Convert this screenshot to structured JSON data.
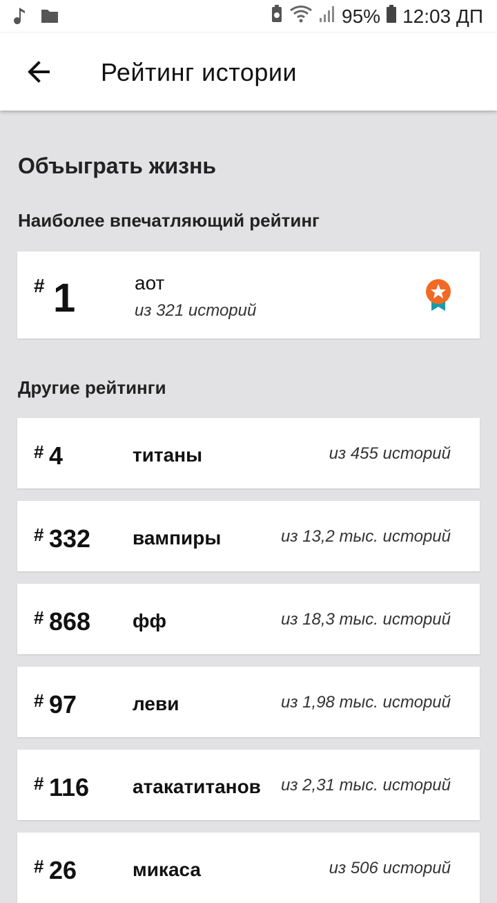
{
  "status_bar": {
    "battery": "95%",
    "time": "12:03 ДП"
  },
  "app_bar": {
    "title": "Рейтинг истории"
  },
  "story": {
    "title": "Объыграть жизнь"
  },
  "sections": {
    "top_heading": "Наиболее впечатляющий рейтинг",
    "other_heading": "Другие рейтинги"
  },
  "top_ranking": {
    "hash": "#",
    "rank": "1",
    "tag": "аот",
    "count": "из 321 историй"
  },
  "other_rankings": [
    {
      "hash": "#",
      "rank": "4",
      "tag": "титаны",
      "count": "из 455 историй"
    },
    {
      "hash": "#",
      "rank": "332",
      "tag": "вампиры",
      "count": "из 13,2 тыс. историй"
    },
    {
      "hash": "#",
      "rank": "868",
      "tag": "фф",
      "count": "из 18,3 тыс. историй"
    },
    {
      "hash": "#",
      "rank": "97",
      "tag": "леви",
      "count": "из 1,98 тыс. историй"
    },
    {
      "hash": "#",
      "rank": "116",
      "tag": "атакатитанов",
      "count": "из 2,31 тыс. историй"
    },
    {
      "hash": "#",
      "rank": "26",
      "tag": "микаса",
      "count": "из 506 историй"
    }
  ]
}
